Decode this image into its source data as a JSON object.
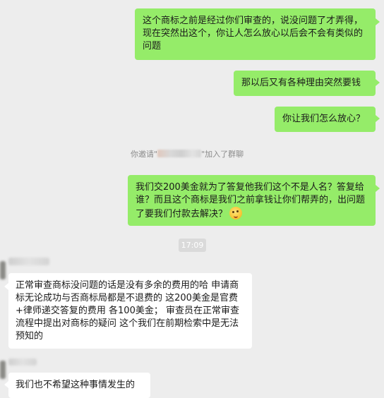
{
  "messages": {
    "m1": "这个商标之前是经过你们审查的，说没问题了才弄得，现在突然出这个，你让人怎么放心以后会不会有类似的问题",
    "m2": "那以后又有各种理由突然要钱",
    "m3": "你让我们怎么放心？",
    "system_prefix": "你邀请\"",
    "system_suffix": "\"加入了群聊",
    "m4": "我们交200美金就为了答复他我们这个不是人名？答复给谁？而且这个商标是我们之前拿钱让你们帮弄的，出问题了要我们付款去解决？",
    "time": "17:09",
    "m5": "正常审查商标没问题的话是没有多余的费用的哈 申请商标无论成功与否商标局都是不退费的 这200美金是官费+律师递交答复的费用 各100美金； 审查员在正常审查流程中提出对商标的疑问 这个我们在前期检索中是无法预知的",
    "m6": "我们也不希望这种事情发生的"
  },
  "icons": {
    "m4_emoji": "dizzy-face-emoji"
  }
}
